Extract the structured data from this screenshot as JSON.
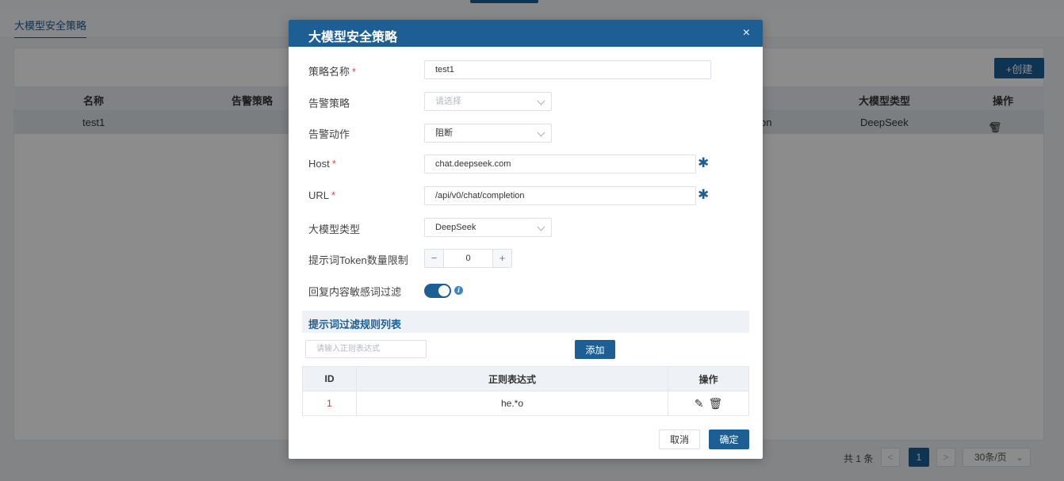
{
  "background": {
    "tab_label": "大模型安全策略",
    "create_label": "+创建",
    "table": {
      "headers": [
        "名称",
        "告警策略",
        "大模型类型",
        "操作"
      ],
      "row": {
        "name": "test1",
        "partial": "on",
        "model_type": "DeepSeek"
      }
    },
    "pagination": {
      "total": "共 1 条",
      "prev": "<",
      "current": "1",
      "next": ">",
      "page_size": "30条/页"
    }
  },
  "modal": {
    "title": "大模型安全策略",
    "close": "×",
    "fields": {
      "name": {
        "label": "策略名称",
        "required": "*",
        "value": "test1"
      },
      "alert_policy": {
        "label": "告警策略",
        "placeholder": "请选择"
      },
      "alert_action": {
        "label": "告警动作",
        "value": "阻断"
      },
      "host": {
        "label": "Host",
        "required": "*",
        "value": "chat.deepseek.com"
      },
      "url": {
        "label": "URL",
        "required": "*",
        "value": "/api/v0/chat/completion"
      },
      "model_type": {
        "label": "大模型类型",
        "value": "DeepSeek"
      },
      "token_limit": {
        "label": "提示词Token数量限制",
        "value": "0",
        "minus": "−",
        "plus": "+"
      },
      "sensitive_filter": {
        "label": "回复内容敏感词过滤",
        "enabled": true
      }
    },
    "rules_section": {
      "title": "提示词过滤规则列表",
      "input_placeholder": "请输入正则表达式",
      "add_label": "添加",
      "headers": [
        "ID",
        "正则表达式",
        "操作"
      ],
      "rows": [
        {
          "id": "1",
          "regex": "he.*o"
        }
      ]
    },
    "footer": {
      "cancel_label": "取消",
      "confirm_label": "确定"
    }
  },
  "colors": {
    "primary": "#1d5f95",
    "required": "#e0483d",
    "info": "#3d86c6"
  },
  "icons": {
    "asterisk": "asterisk-icon",
    "edit": "edit-icon",
    "delete": "delete-icon",
    "info": "info-icon"
  }
}
